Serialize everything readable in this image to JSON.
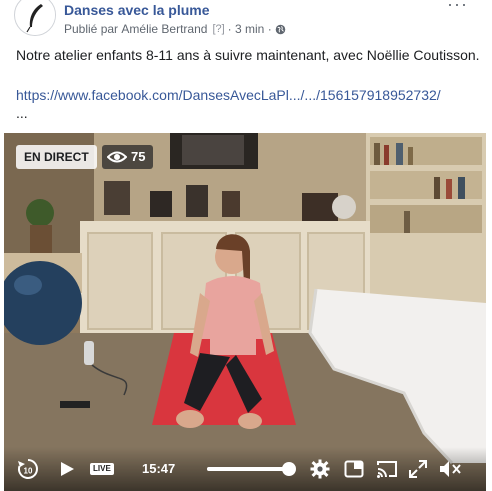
{
  "post": {
    "page_name": "Danses avec la plume",
    "published_prefix": "Publié par",
    "author": "Amélie Bertrand",
    "badge": "[?]",
    "separator": "·",
    "time_ago": "3 min",
    "separator2": "·",
    "more_label": "···",
    "text": "Notre atelier enfants 8-11 ans à suivre maintenant, avec Noëllie Coutisson.",
    "link": "https://www.facebook.com/DansesAvecLaPl.../.../156157918952732/",
    "ellipsis": "...",
    "privacy_icon": "globe-icon"
  },
  "video": {
    "live_badge": "EN DIRECT",
    "viewer_count": "75",
    "viewer_icon": "eye-icon",
    "controls": {
      "rewind_icon": "rewind-10-icon",
      "rewind_label": "10",
      "play_icon": "play-icon",
      "live_label": "LIVE",
      "time": "15:47",
      "progress": 1.0,
      "settings_icon": "gear-icon",
      "pip_icon": "picture-in-picture-icon",
      "cast_icon": "cast-icon",
      "fullscreen_icon": "fullscreen-icon",
      "mute_icon": "volume-muted-icon"
    }
  },
  "colors": {
    "link": "#385898",
    "text": "#1c1e21",
    "meta": "#606770",
    "mat": "#d9363e"
  }
}
